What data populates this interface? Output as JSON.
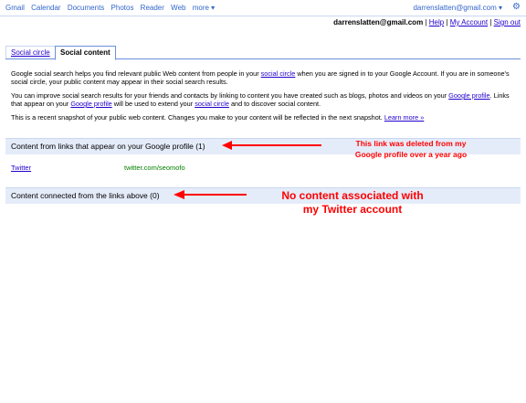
{
  "topnav": {
    "items": [
      "Gmail",
      "Calendar",
      "Documents",
      "Photos",
      "Reader",
      "Web",
      "more ▾"
    ],
    "account_email": "darrenslatten@gmail.com ▾",
    "gear_icon": "gear-icon"
  },
  "user_row": {
    "email": "darrenslatten@gmail.com",
    "links": [
      "Help",
      "My Account",
      "Sign out"
    ]
  },
  "tabs": [
    {
      "label": "Social circle",
      "active": false
    },
    {
      "label": "Social content",
      "active": true
    }
  ],
  "intro": {
    "p1_a": "Google social search helps you find relevant public Web content from people in your ",
    "p1_link": "social circle",
    "p1_b": " when you are signed in to your Google Account. If you are in someone's social circle, your public content may appear in their social search results.",
    "p2_a": "You can improve social search results for your friends and contacts by linking to content you have created such as blogs, photos and videos on your ",
    "p2_link1": "Google profile",
    "p2_b": ". Links that appear on your ",
    "p2_link2": "Google profile",
    "p2_c": " will be used to extend your ",
    "p2_link3": "social circle",
    "p2_d": " and to discover social content.",
    "p3_a": "This is a recent snapshot of your public web content. Changes you make to your content will be reflected in the next snapshot. ",
    "p3_link": "Learn more »"
  },
  "sections": {
    "links_title": "Content from links that appear on your Google profile (1)",
    "connected_title": "Content connected from the links above (0)"
  },
  "links_table": [
    {
      "name": "Twitter",
      "url": "twitter.com/seomofo"
    }
  ],
  "annotations": {
    "note1_line1": "This link was deleted from my",
    "note1_line2": "Google profile over a year ago",
    "note2_line1": "No content associated with",
    "note2_line2": "my Twitter account",
    "color": "#ff0000"
  }
}
